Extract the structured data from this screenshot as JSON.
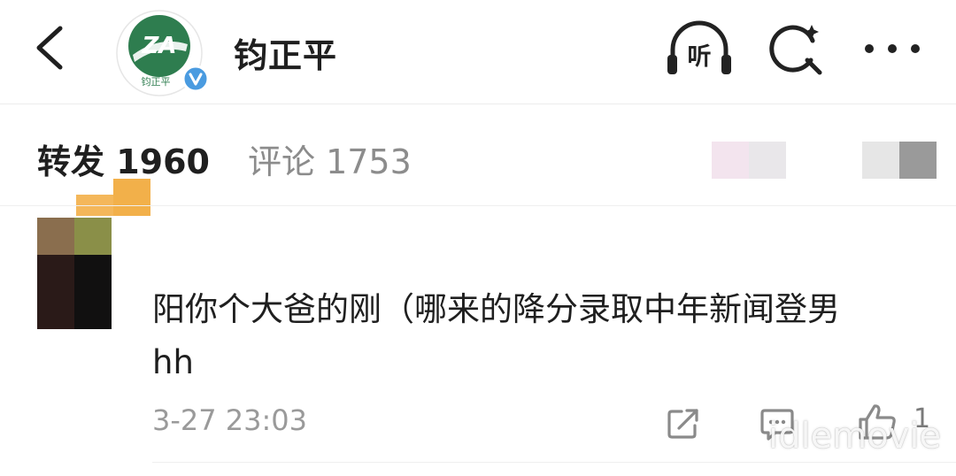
{
  "header": {
    "account_name": "钧正平",
    "avatar_logo_text": "ZA",
    "avatar_caption": "钧正平",
    "listen_label": "听"
  },
  "tabs": [
    {
      "label": "转发 1960",
      "active": true
    },
    {
      "label": "评论 1753",
      "active": false
    }
  ],
  "post": {
    "text": "阳你个大爸的刚（哪来的降分录取中年新闻登男\nhh",
    "timestamp": "3-27 23:03",
    "like_count": "1"
  },
  "watermark": "idlemovie",
  "colors": {
    "avatar_green": "#2e7d4f",
    "verified_blue": "#4a9be0",
    "active_tab_text": "#1f1f1f",
    "inactive_tab_text": "#8c8c8c",
    "timestamp_text": "#9a9a9a"
  }
}
